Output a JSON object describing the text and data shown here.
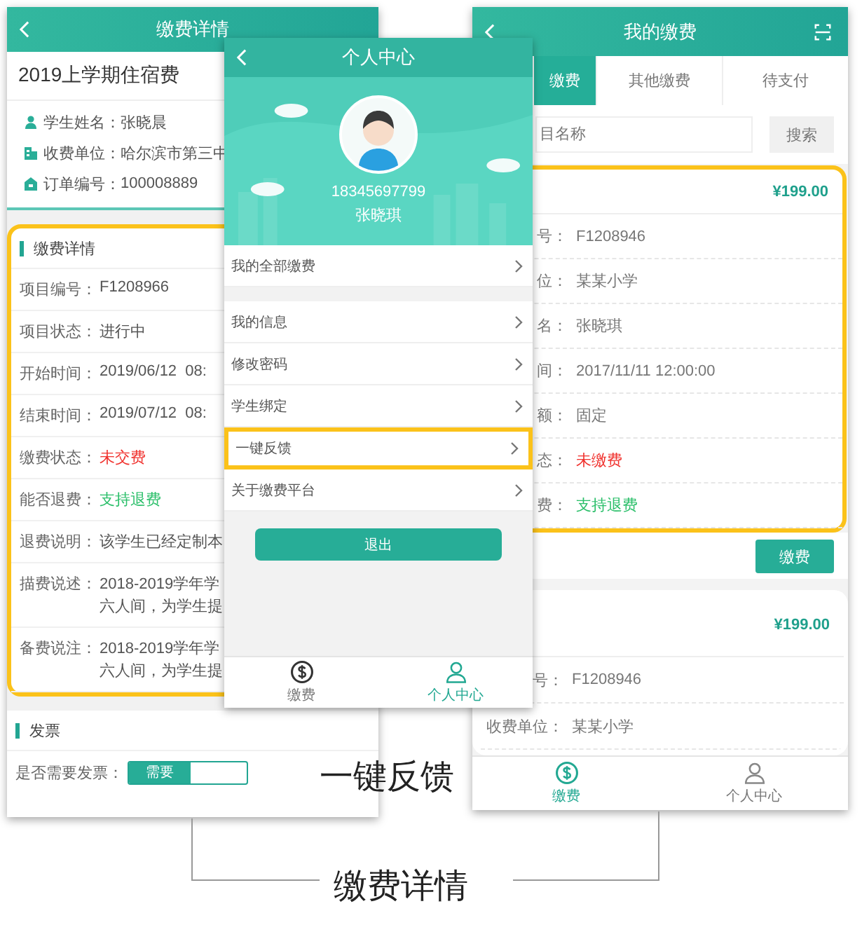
{
  "left_screen": {
    "title": "缴费详情",
    "item_title": "2019上学期住宿费",
    "info": [
      {
        "kind": "person",
        "label": "学生姓名：",
        "value": "张晓晨"
      },
      {
        "kind": "building",
        "label": "收费单位：",
        "value": "哈尔滨市第三中"
      },
      {
        "kind": "order",
        "label": "订单编号：",
        "value": "100008889"
      }
    ],
    "detail": {
      "title": "缴费详情",
      "highlighted": true,
      "rows": [
        {
          "label": "项目编号：",
          "lines": [
            "F1208966"
          ]
        },
        {
          "label": "项目状态：",
          "lines": [
            "进行中"
          ]
        },
        {
          "label": "开始时间：",
          "lines": [
            "2019/06/12  08:"
          ]
        },
        {
          "label": "结束时间：",
          "lines": [
            "2019/07/12  08:"
          ]
        },
        {
          "label": "缴费状态：",
          "lines": [
            "未交费"
          ],
          "color": "#f0302c"
        },
        {
          "label": "能否退费：",
          "lines": [
            "支持退费"
          ],
          "color": "#2bbf6a"
        },
        {
          "label": "退费说明：",
          "lines": [
            "该学生已经定制本"
          ]
        },
        {
          "label": "描费说述：",
          "lines": [
            "2018-2019学年学",
            "六人间，为学生提"
          ]
        },
        {
          "label": "备费说注：",
          "lines": [
            "2018-2019学年学",
            "六人间，为学生提"
          ]
        }
      ]
    },
    "invoice": {
      "title": "发票",
      "label": "是否需要发票：",
      "toggle": {
        "label": "需要",
        "on": true
      }
    }
  },
  "middle_screen": {
    "title": "个人中心",
    "phone": "18345697799",
    "name": "张晓琪",
    "menu_groups": [
      {
        "items": [
          {
            "label": "我的全部缴费",
            "highlighted": false
          }
        ]
      },
      {
        "items": [
          {
            "label": "我的信息",
            "highlighted": false
          },
          {
            "label": "修改密码",
            "highlighted": false
          },
          {
            "label": "学生绑定",
            "highlighted": false
          },
          {
            "label": "一键反馈",
            "highlighted": true
          },
          {
            "label": "关于缴费平台",
            "highlighted": false
          }
        ]
      }
    ],
    "logout": "退出",
    "tab_bar": [
      {
        "kind": "dollar",
        "label": "缴费",
        "selected": false
      },
      {
        "kind": "person",
        "label": "个人中心",
        "selected": true
      }
    ]
  },
  "right_screen": {
    "title": "我的缴费",
    "tabs": [
      {
        "label": "缴费",
        "selected": true
      },
      {
        "label": "其他缴费",
        "selected": false
      },
      {
        "label": "待支付",
        "selected": false
      }
    ],
    "search": {
      "placeholder": "目名称",
      "button": "搜索"
    },
    "cards": [
      {
        "price": "¥199.00",
        "highlighted": true,
        "rows": [
          {
            "label": "号：",
            "value": "F1208946"
          },
          {
            "label": "位：",
            "value": "某某小学"
          },
          {
            "label": "名：",
            "value": "张晓琪"
          },
          {
            "label": "间：",
            "value": "2017/11/11 12:00:00"
          },
          {
            "label": "额：",
            "value": "固定"
          },
          {
            "label": "态：",
            "value": "未缴费",
            "color": "#f0302c"
          },
          {
            "label": "费：",
            "value": "支持退费",
            "color": "#2bbf6a"
          }
        ],
        "button": "缴费"
      },
      {
        "price": "¥199.00",
        "highlighted": false,
        "rows": [
          {
            "label": "号：",
            "value": "F1208946"
          },
          {
            "label": "收费单位：",
            "value": "某某小学"
          }
        ]
      }
    ],
    "tab_bar": [
      {
        "kind": "dollar",
        "label": "缴费",
        "selected": true
      },
      {
        "kind": "person",
        "label": "个人中心",
        "selected": false
      }
    ]
  },
  "callouts": [
    {
      "label": "一键反馈"
    },
    {
      "label": "缴费详情"
    }
  ]
}
